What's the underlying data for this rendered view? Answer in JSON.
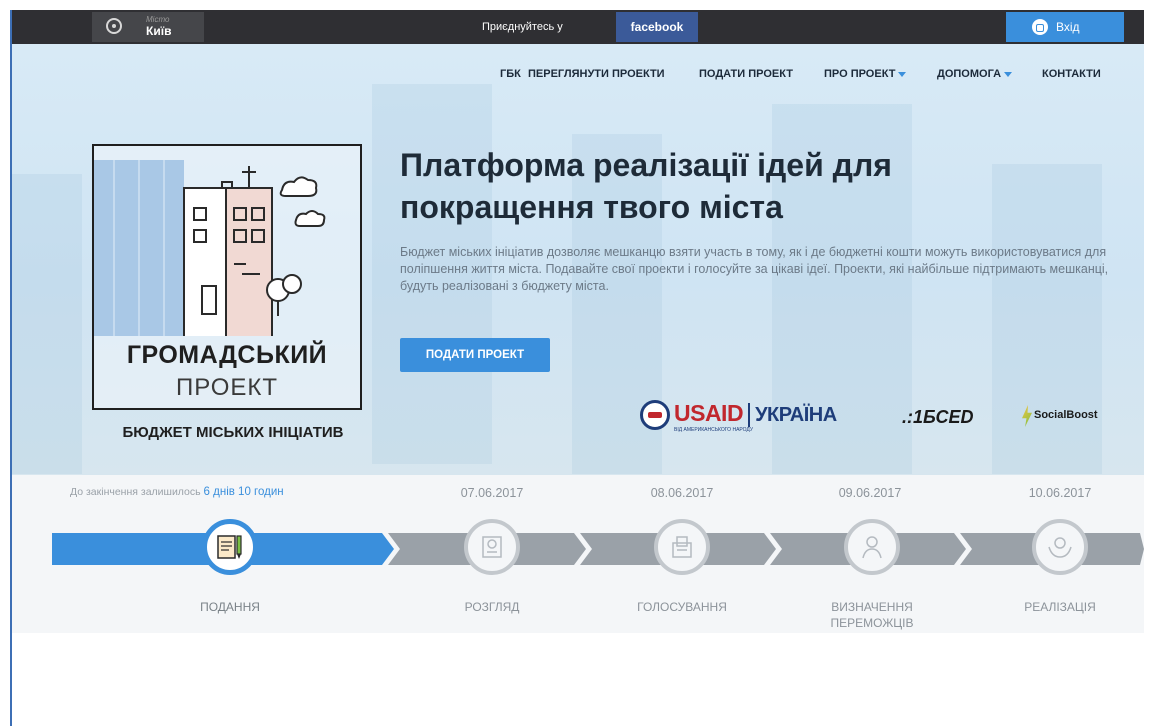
{
  "topbar": {
    "city_label": "Місто",
    "city_name": "Київ",
    "join_text": "Приєднуйтесь у",
    "facebook_label": "facebook",
    "login_label": "Вхід"
  },
  "nav": {
    "items": [
      {
        "label": "ГБК"
      },
      {
        "label": "ПЕРЕГЛЯНУТИ ПРОЕКТИ"
      },
      {
        "label": "ПОДАТИ ПРОЕКТ"
      },
      {
        "label": "ПРО ПРОЕКТ"
      },
      {
        "label": "ДОПОМОГА"
      },
      {
        "label": "КОНТАКТИ"
      }
    ]
  },
  "logo": {
    "title": "ГРОМАДСЬКИЙ",
    "subtitle": "ПРОЕКТ",
    "tagline": "БЮДЖЕТ МІСЬКИХ ІНІЦІАТИВ"
  },
  "hero": {
    "headline_line1": "Платформа реалізації ідей для",
    "headline_line2": "покращення твого міста",
    "description": "Бюджет міських ініціатив дозволяє мешканцю взяти участь в тому, як і де бюджетні кошти можуть використовуватися для поліпшення життя міста. Подавайте свої проекти і голосуйте за цікаві ідеї. Проекти, які найбільше підтримають мешканці, будуть реалізовані з бюджету міста.",
    "cta_label": "ПОДАТИ ПРОЕКТ"
  },
  "partners": {
    "usaid": "USAID",
    "usaid_country": "УКРАЇНА",
    "usaid_small": "ВІД АМЕРИКАНСЬКОГО НАРОДУ",
    "ibsed": ".:1БСЕD",
    "socialboost": "SocialBoost"
  },
  "timeline": {
    "remaining_prefix": "До закінчення залишилось",
    "remaining_value": "6 днів 10 годин",
    "stages": [
      {
        "label": "ПОДАННЯ",
        "date": "",
        "icon": "document-pen-icon",
        "active": true
      },
      {
        "label": "РОЗГЛЯД",
        "date": "07.06.2017",
        "icon": "certificate-icon",
        "active": false
      },
      {
        "label": "ГОЛОСУВАННЯ",
        "date": "08.06.2017",
        "icon": "ballot-box-icon",
        "active": false
      },
      {
        "label": "ВИЗНАЧЕННЯ ПЕРЕМОЖЦІВ",
        "label_line1": "ВИЗНАЧЕННЯ",
        "label_line2": "ПЕРЕМОЖЦІВ",
        "date": "09.06.2017",
        "icon": "winner-person-icon",
        "active": false
      },
      {
        "label": "РЕАЛІЗАЦІЯ",
        "date": "10.06.2017",
        "icon": "hands-coin-icon",
        "active": false
      }
    ]
  },
  "colors": {
    "accent": "#3a8fdc",
    "topbar": "#2f2f33",
    "facebook": "#3b5a99",
    "timeline_inactive": "#9aa1a8"
  }
}
